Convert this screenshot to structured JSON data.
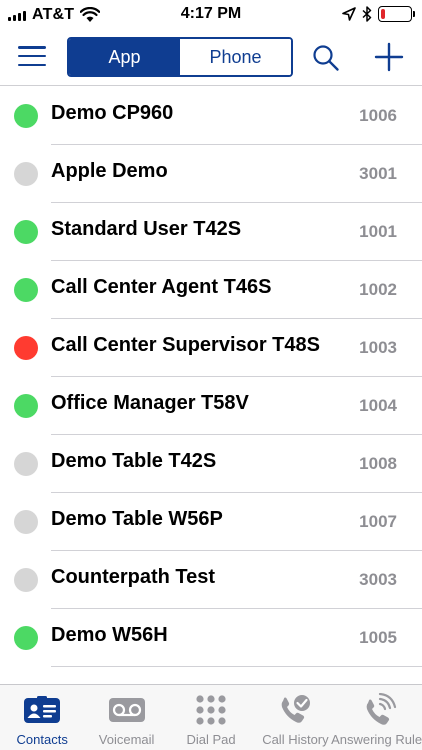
{
  "status_bar": {
    "carrier": "AT&T",
    "time": "4:17 PM",
    "battery_level": 0.15,
    "battery_color": "#e0262b"
  },
  "nav": {
    "segments": [
      {
        "label": "App",
        "selected": true
      },
      {
        "label": "Phone",
        "selected": false
      }
    ],
    "icons": [
      "menu-icon",
      "search-icon",
      "plus-icon"
    ],
    "accent": "#0f3d91"
  },
  "contacts": [
    {
      "name": "Demo CP960",
      "ext": "1006",
      "status": "online"
    },
    {
      "name": "Apple Demo",
      "ext": "3001",
      "status": "offline"
    },
    {
      "name": "Standard User T42S",
      "ext": "1001",
      "status": "online"
    },
    {
      "name": "Call Center Agent T46S",
      "ext": "1002",
      "status": "online"
    },
    {
      "name": "Call Center Supervisor T48S",
      "ext": "1003",
      "status": "busy"
    },
    {
      "name": "Office Manager T58V",
      "ext": "1004",
      "status": "online"
    },
    {
      "name": "Demo Table T42S",
      "ext": "1008",
      "status": "offline"
    },
    {
      "name": "Demo Table W56P",
      "ext": "1007",
      "status": "offline"
    },
    {
      "name": "Counterpath Test",
      "ext": "3003",
      "status": "offline"
    },
    {
      "name": "Demo W56H",
      "ext": "1005",
      "status": "online"
    }
  ],
  "status_colors": {
    "online": "#4cd964",
    "offline": "#d6d6d6",
    "busy": "#ff3b30"
  },
  "tabbar": {
    "tabs": [
      {
        "label": "Contacts",
        "icon": "contacts-card-icon",
        "active": true
      },
      {
        "label": "Voicemail",
        "icon": "voicemail-icon",
        "active": false
      },
      {
        "label": "Dial Pad",
        "icon": "dialpad-icon",
        "active": false
      },
      {
        "label": "Call History",
        "icon": "call-history-icon",
        "active": false
      },
      {
        "label": "Answering Rules",
        "icon": "answering-rules-icon",
        "active": false
      }
    ]
  }
}
